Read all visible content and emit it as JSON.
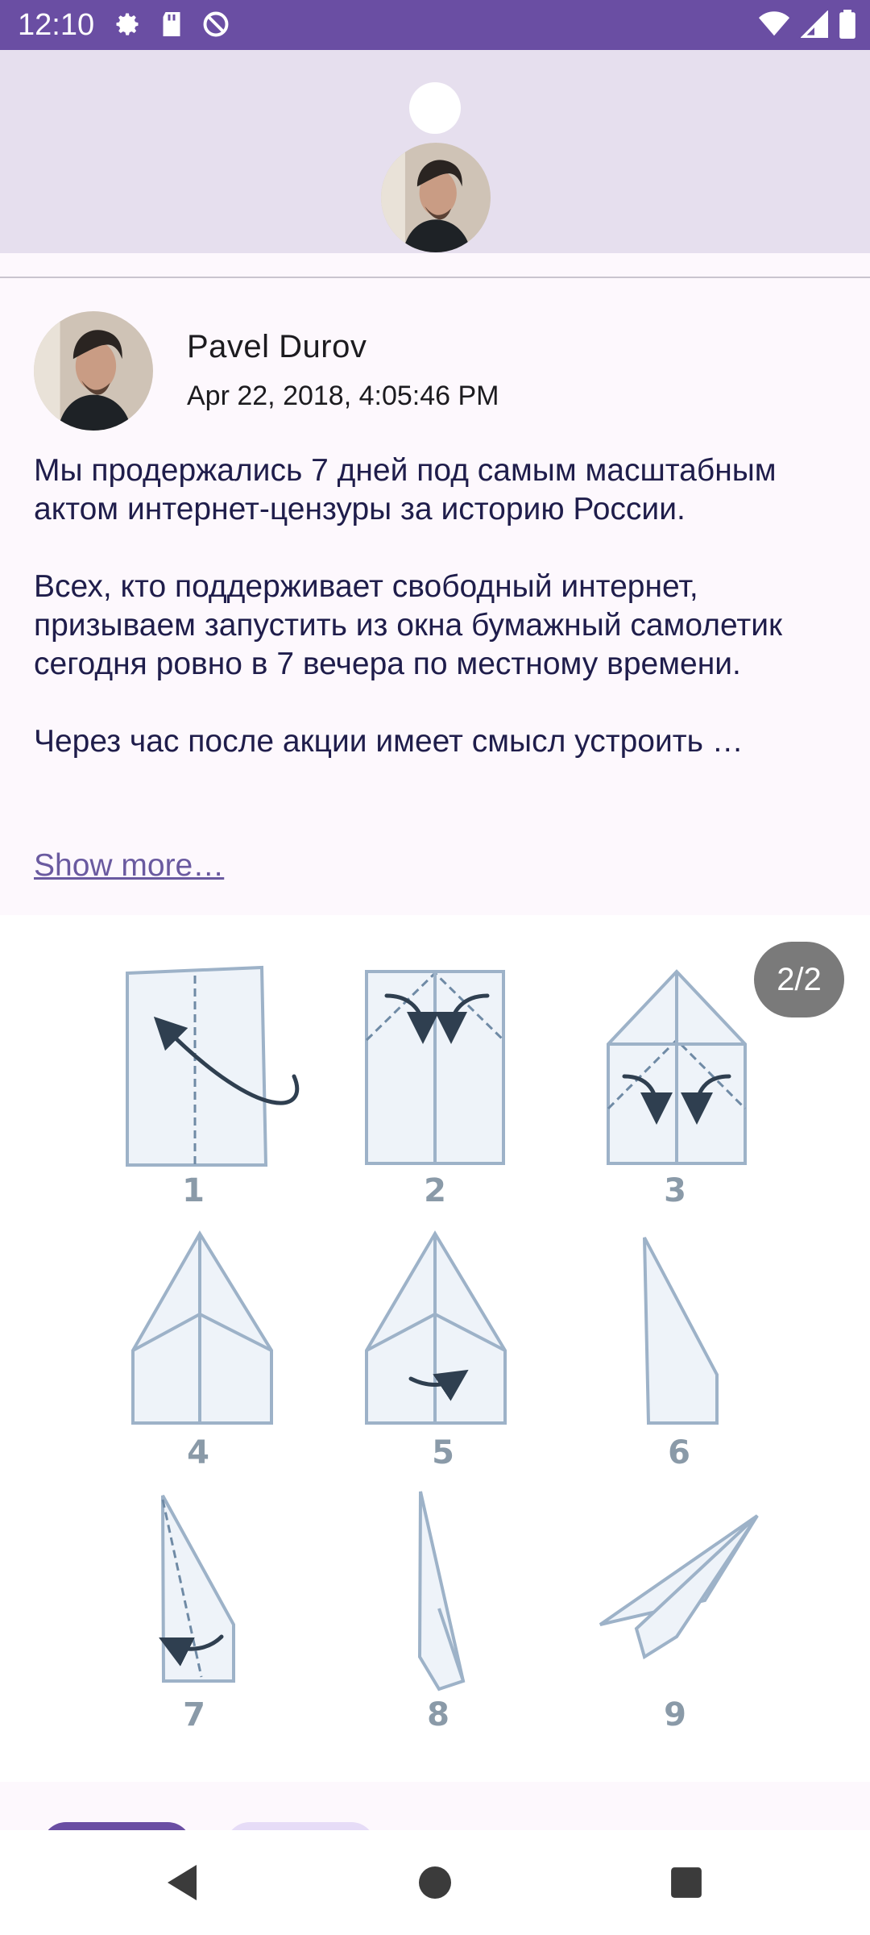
{
  "status_bar": {
    "time": "12:10",
    "left_icons": [
      "gear-icon",
      "sd-card-icon",
      "at-sign-icon"
    ],
    "right_icons": [
      "wifi-icon",
      "signal-icon",
      "battery-icon"
    ],
    "color": "#6a4ea3"
  },
  "post": {
    "author": "Pavel Durov",
    "date": "Apr 22, 2018, 4:05:46 PM",
    "paragraphs": [
      "Мы продержались 7 дней под самым масштабным актом интернет-цензуры за историю России.",
      "Всех, кто поддерживает свободный интернет, призываем запустить из окна бумажный самолетик сегодня ровно в 7 вечера по местному времени.",
      "Через час после акции имеет смысл устроить …"
    ],
    "show_more": "Show more…"
  },
  "media": {
    "page_indicator": "2/2",
    "step_labels": [
      "1",
      "2",
      "3",
      "4",
      "5",
      "6",
      "7",
      "8",
      "9"
    ]
  },
  "nav": {
    "icons": [
      "back-icon",
      "home-icon",
      "recents-icon"
    ]
  },
  "colors": {
    "accent": "#6a4ea3",
    "header_bg": "#e6dfee",
    "text": "#1f1d4b",
    "link": "#6a5aa0"
  }
}
